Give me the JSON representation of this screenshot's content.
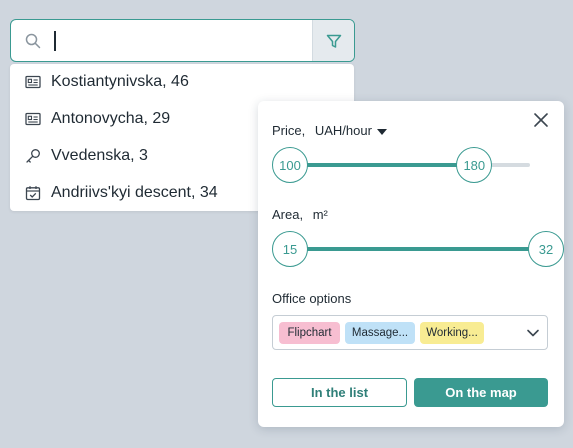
{
  "search": {
    "value": "",
    "placeholder": ""
  },
  "suggestions": [
    {
      "icon": "id-card-icon",
      "label": "Kostiantynivska, 46"
    },
    {
      "icon": "id-card-icon",
      "label": "Antonovycha, 29"
    },
    {
      "icon": "key-icon",
      "label": "Vvedenska, 3"
    },
    {
      "icon": "calendar-check-icon",
      "label": "Andriivs'kyi descent, 34"
    }
  ],
  "filters": {
    "price": {
      "label": "Price,",
      "unit": "UAH/hour",
      "min": "100",
      "max": "180",
      "min_fraction": 0.0,
      "max_fraction": 0.72
    },
    "area": {
      "label": "Area,",
      "unit": "m²",
      "min": "15",
      "max": "32",
      "min_fraction": 0.0,
      "max_fraction": 1.0
    },
    "office_options": {
      "label": "Office options",
      "tags": [
        {
          "text": "Flipchart",
          "color": "#f7bed1"
        },
        {
          "text": "Massage...",
          "color": "#bfe1f7"
        },
        {
          "text": "Working...",
          "color": "#f8ec93"
        }
      ]
    },
    "buttons": {
      "list": "In the list",
      "map": "On the map"
    }
  },
  "colors": {
    "accent": "#3a9a91",
    "background": "#cfd6de"
  }
}
